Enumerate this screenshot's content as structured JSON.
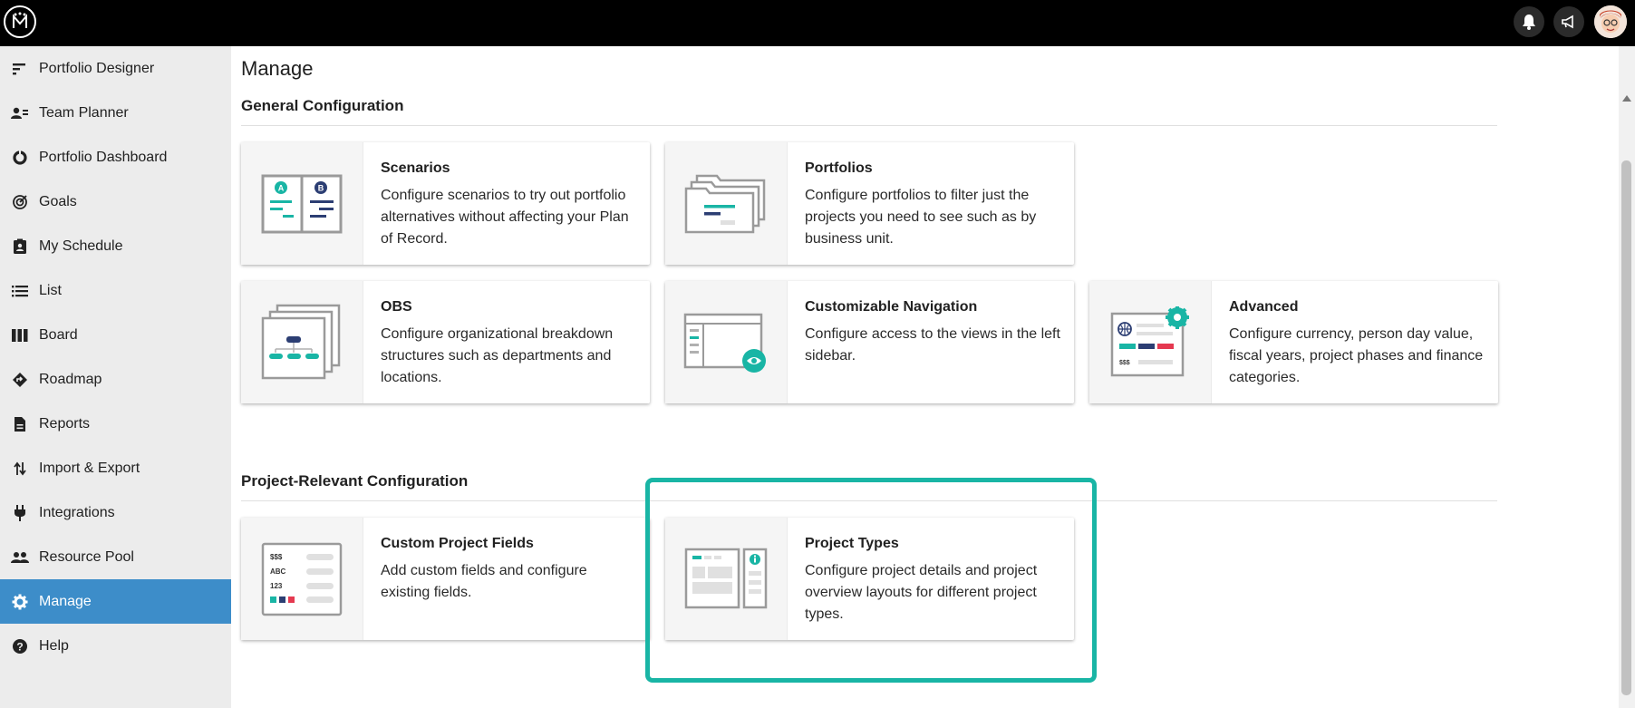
{
  "header": {
    "logo_alt": "M"
  },
  "sidebar": {
    "items": [
      {
        "label": "Portfolio Designer",
        "icon": "portfolio-designer-icon"
      },
      {
        "label": "Team Planner",
        "icon": "team-planner-icon"
      },
      {
        "label": "Portfolio Dashboard",
        "icon": "dashboard-icon"
      },
      {
        "label": "Goals",
        "icon": "goals-icon"
      },
      {
        "label": "My Schedule",
        "icon": "schedule-icon"
      },
      {
        "label": "List",
        "icon": "list-icon"
      },
      {
        "label": "Board",
        "icon": "board-icon"
      },
      {
        "label": "Roadmap",
        "icon": "roadmap-icon"
      },
      {
        "label": "Reports",
        "icon": "reports-icon"
      },
      {
        "label": "Import & Export",
        "icon": "import-export-icon"
      },
      {
        "label": "Integrations",
        "icon": "integrations-icon"
      },
      {
        "label": "Resource Pool",
        "icon": "resource-pool-icon"
      },
      {
        "label": "Manage",
        "icon": "gear-icon",
        "active": true
      },
      {
        "label": "Help",
        "icon": "help-icon"
      }
    ]
  },
  "main": {
    "title": "Manage",
    "general": {
      "title": "General Configuration",
      "cards": [
        {
          "title": "Scenarios",
          "desc": "Configure scenarios to try out portfolio alternatives without affecting your Plan of Record."
        },
        {
          "title": "Portfolios",
          "desc": "Configure portfolios to filter just the projects you need to see such as by business unit."
        },
        {
          "title": "OBS",
          "desc": "Configure organizational breakdown structures such as departments and locations."
        },
        {
          "title": "Customizable Navigation",
          "desc": "Configure access to the views in the left sidebar."
        },
        {
          "title": "Advanced",
          "desc": "Configure currency, person day value, fiscal years, project phases and finance categories."
        }
      ]
    },
    "project": {
      "title": "Project-Relevant Configuration",
      "cards": [
        {
          "title": "Custom Project Fields",
          "desc": "Add custom fields and configure existing fields."
        },
        {
          "title": "Project Types",
          "desc": "Configure project details and project overview layouts for different project types."
        }
      ]
    }
  },
  "thumb_text": {
    "scenario_a": "A",
    "scenario_b": "B",
    "currency": "$$$",
    "abc": "ABC",
    "num": "123",
    "adv_currency": "$$$"
  },
  "colors": {
    "accent": "#19b5a5",
    "navy": "#2c3e73",
    "active_nav": "#3d8dc9",
    "red": "#e53950"
  }
}
